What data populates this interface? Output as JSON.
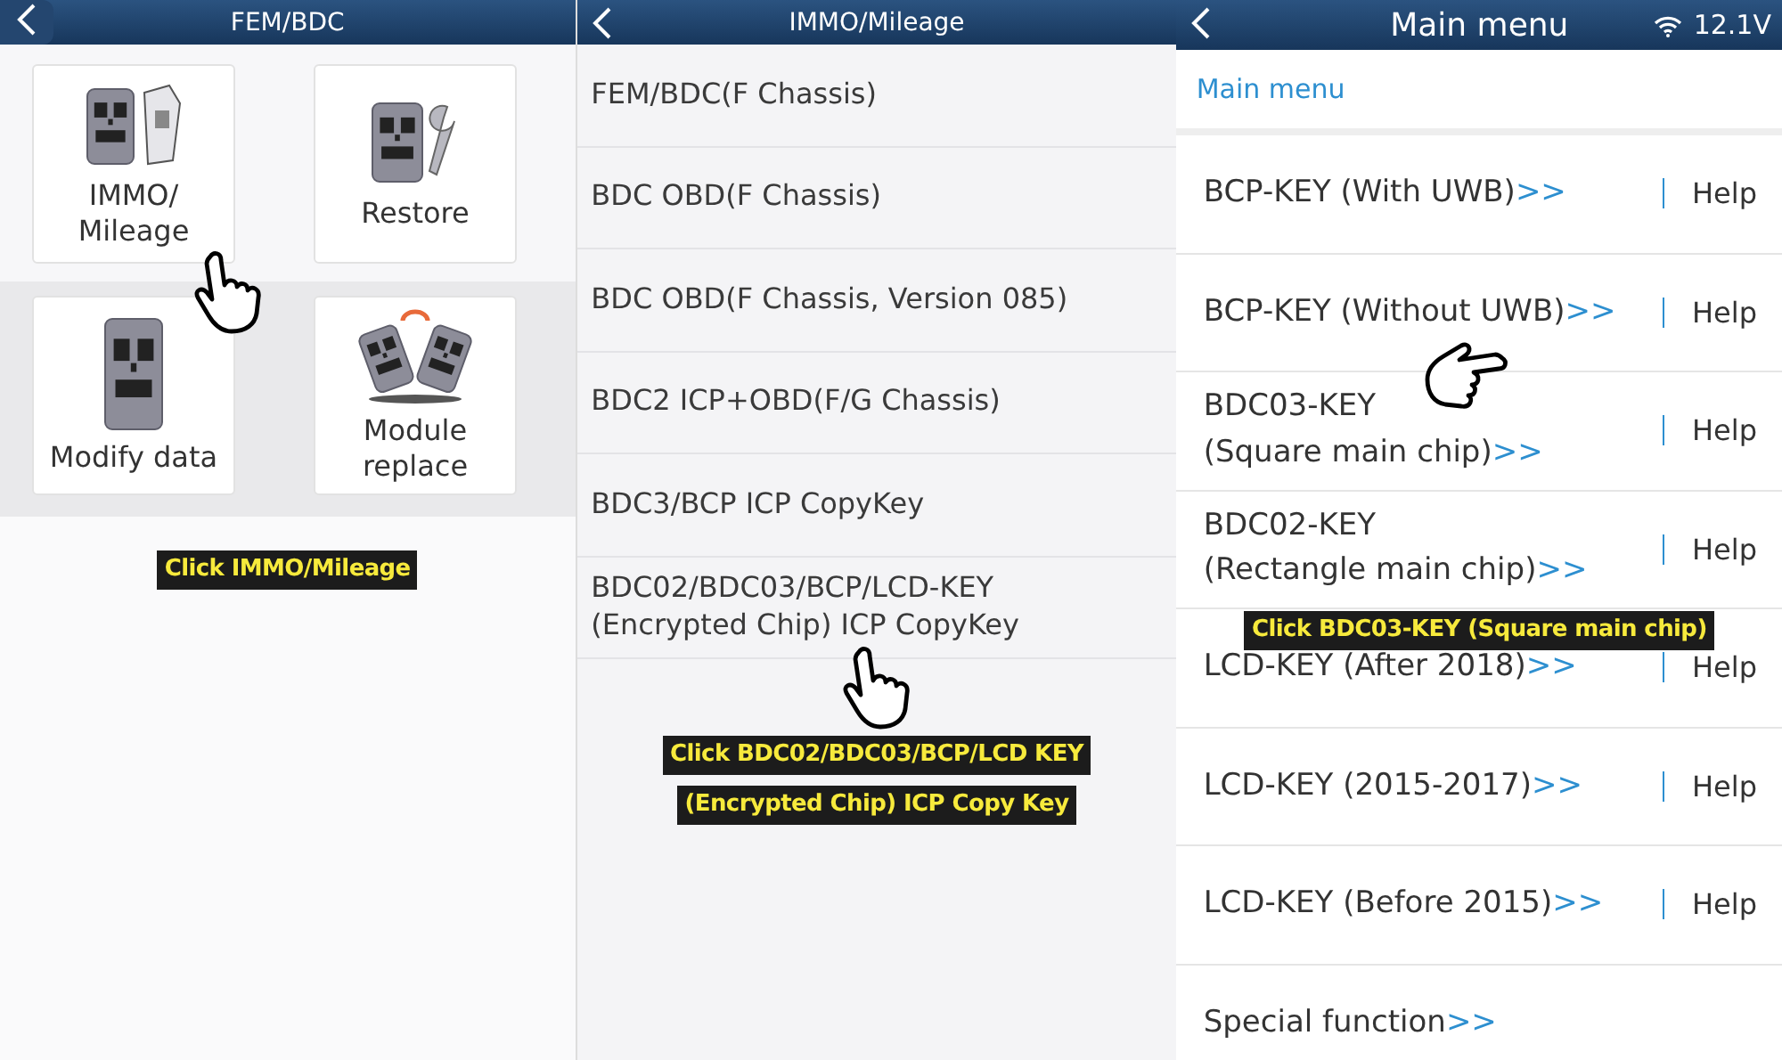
{
  "panels": [
    {
      "kind": "grid",
      "title": "FEM/BDC",
      "tiles": [
        {
          "label": [
            "IMMO/",
            "Mileage"
          ]
        },
        {
          "label": [
            "Restore"
          ]
        },
        {
          "label": [
            "Modify data"
          ]
        },
        {
          "label": [
            "Module",
            "replace"
          ]
        }
      ],
      "caption": [
        "Click IMMO/Mileage"
      ]
    },
    {
      "kind": "list",
      "title": "IMMO/Mileage",
      "items": [
        [
          "FEM/BDC(F Chassis)"
        ],
        [
          "BDC OBD(F Chassis)"
        ],
        [
          "BDC OBD(F Chassis, Version 085)"
        ],
        [
          "BDC2 ICP+OBD(F/G Chassis)"
        ],
        [
          "BDC3/BCP ICP CopyKey"
        ],
        [
          "BDC02/BDC03/BCP/LCD-KEY",
          "(Encrypted Chip) ICP CopyKey"
        ]
      ],
      "caption": [
        "Click BDC02/BDC03/BCP/LCD KEY",
        "(Encrypted Chip) ICP Copy Key"
      ]
    },
    {
      "kind": "menu",
      "title": "Main menu",
      "voltage": "12.1V",
      "breadcrumb": "Main menu",
      "items": [
        {
          "label": [
            "BCP-KEY (With UWB)"
          ],
          "arrow": ">>",
          "help": "Help"
        },
        {
          "label": [
            "BCP-KEY (Without UWB)"
          ],
          "arrow": ">>",
          "help": "Help"
        },
        {
          "label": [
            "BDC03-KEY",
            "(Square main chip)"
          ],
          "arrow": ">>",
          "help": "Help"
        },
        {
          "label": [
            "BDC02-KEY",
            "(Rectangle main chip)"
          ],
          "arrow": ">>",
          "help": "Help"
        },
        {
          "label": [
            "LCD-KEY (After 2018)"
          ],
          "arrow": ">>",
          "help": "Help"
        },
        {
          "label": [
            "LCD-KEY (2015-2017)"
          ],
          "arrow": ">>",
          "help": "Help"
        },
        {
          "label": [
            "LCD-KEY (Before 2015)"
          ],
          "arrow": ">>",
          "help": "Help"
        },
        {
          "label": [
            "Special function"
          ],
          "arrow": ">>"
        }
      ],
      "caption": [
        "Click BDC03-KEY (Square main chip)"
      ]
    }
  ]
}
